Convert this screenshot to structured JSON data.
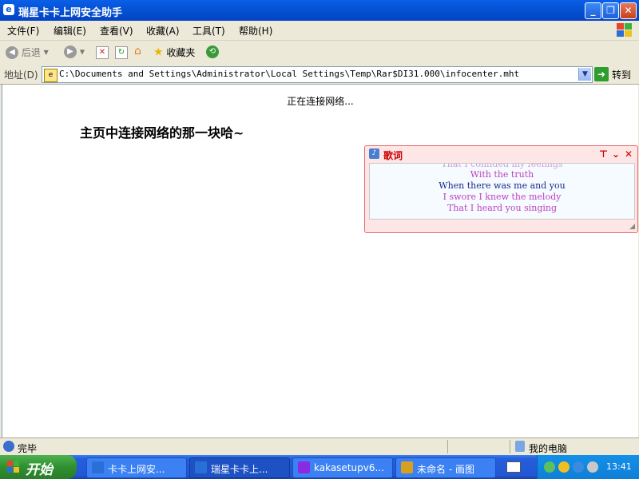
{
  "window": {
    "title": "瑞星卡卡上网安全助手"
  },
  "menu": {
    "items": [
      "文件(F)",
      "编辑(E)",
      "查看(V)",
      "收藏(A)",
      "工具(T)",
      "帮助(H)"
    ]
  },
  "toolbar": {
    "back_label": "后退",
    "favorites_label": "收藏夹"
  },
  "address": {
    "label": "地址(D)",
    "url": "C:\\Documents and Settings\\Administrator\\Local Settings\\Temp\\Rar$DI31.000\\infocenter.mht",
    "go_label": "转到"
  },
  "page": {
    "connecting_text": "正在连接网络...",
    "heading": "主页中连接网络的那一块哈~"
  },
  "lyrics": {
    "title": "歌词",
    "lines": [
      {
        "text": "That I confided my feelings",
        "color": "#c9a0d8"
      },
      {
        "text": "With the truth",
        "color": "#c040c0"
      },
      {
        "text": "When there was me and you",
        "color": "#1a2a8a"
      },
      {
        "text": "I swore I knew the melody",
        "color": "#c040c0"
      },
      {
        "text": "That I heard you singing",
        "color": "#c040c0"
      },
      {
        "text": "",
        "color": "#d8b8e8"
      }
    ]
  },
  "status": {
    "text": "完毕",
    "zone": "我的电脑"
  },
  "taskbar": {
    "start_label": "开始",
    "tasks": [
      {
        "label": "卡卡上网安...",
        "icon_color": "#2a6fd8",
        "active": false
      },
      {
        "label": "瑞星卡卡上...",
        "icon_color": "#2a6fd8",
        "active": true
      },
      {
        "label": "kakasetupv6...",
        "icon_color": "#8a2be2",
        "active": false
      },
      {
        "label": "未命名 - 画图",
        "icon_color": "#d8a020",
        "active": false
      }
    ],
    "clock": "13:41"
  },
  "colors": {
    "title_blue": "#0553d6",
    "lyric_border": "#e56a6a",
    "lyric_title": "#cc0000"
  }
}
